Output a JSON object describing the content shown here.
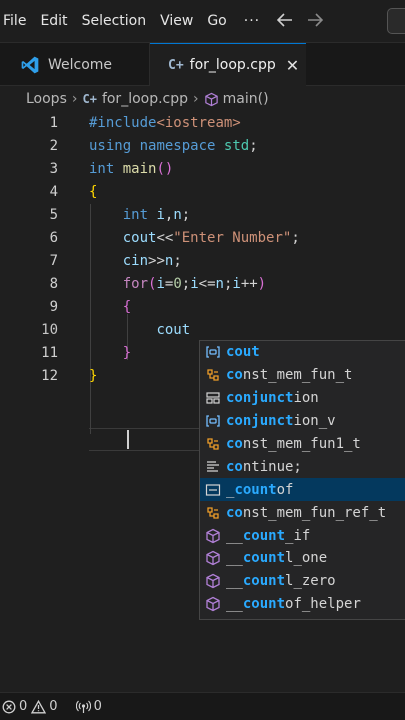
{
  "menubar": {
    "items": [
      "File",
      "Edit",
      "Selection",
      "View",
      "Go"
    ],
    "more": "···",
    "back_icon": "arrow-left-icon",
    "forward_icon": "arrow-right-icon"
  },
  "tabs": [
    {
      "label": "Welcome",
      "icon": "vscode-logo-icon"
    },
    {
      "label": "for_loop.cpp",
      "icon": "cpp-file-icon",
      "icon_glyph": "C+",
      "close": "✕"
    }
  ],
  "breadcrumb": {
    "folder": "Loops",
    "file": "for_loop.cpp",
    "symbol": "main()"
  },
  "editor": {
    "lines": [
      {
        "n": "1",
        "tokens": [
          [
            "c-pre",
            "#include"
          ],
          [
            "c-str",
            "<iostream>"
          ]
        ]
      },
      {
        "n": "2",
        "tokens": [
          [
            "c-kw",
            "using"
          ],
          [
            "c-txt",
            " "
          ],
          [
            "c-kw",
            "namespace"
          ],
          [
            "c-txt",
            " "
          ],
          [
            "c-ns",
            "std"
          ],
          [
            "c-txt",
            ";"
          ]
        ]
      },
      {
        "n": "3",
        "tokens": [
          [
            "c-kw",
            "int"
          ],
          [
            "c-txt",
            " "
          ],
          [
            "c-fn",
            "main"
          ],
          [
            "c-brace2",
            "()"
          ]
        ]
      },
      {
        "n": "4",
        "tokens": [
          [
            "c-brace",
            "{"
          ]
        ]
      },
      {
        "n": "5",
        "tokens": [
          [
            "c-txt",
            "    "
          ],
          [
            "c-kw",
            "int"
          ],
          [
            "c-txt",
            " "
          ],
          [
            "c-var",
            "i"
          ],
          [
            "c-txt",
            ","
          ],
          [
            "c-var",
            "n"
          ],
          [
            "c-txt",
            ";"
          ]
        ]
      },
      {
        "n": "6",
        "tokens": [
          [
            "c-txt",
            "    "
          ],
          [
            "c-var",
            "cout"
          ],
          [
            "c-txt",
            "<<"
          ],
          [
            "c-str",
            "\"Enter Number\""
          ],
          [
            "c-txt",
            ";"
          ]
        ]
      },
      {
        "n": "7",
        "tokens": [
          [
            "c-txt",
            "    "
          ],
          [
            "c-var",
            "cin"
          ],
          [
            "c-txt",
            ">>"
          ],
          [
            "c-var",
            "n"
          ],
          [
            "c-txt",
            ";"
          ]
        ]
      },
      {
        "n": "8",
        "tokens": [
          [
            "c-txt",
            "    "
          ],
          [
            "c-kw2",
            "for"
          ],
          [
            "c-brace2",
            "("
          ],
          [
            "c-var",
            "i"
          ],
          [
            "c-txt",
            "="
          ],
          [
            "c-num",
            "0"
          ],
          [
            "c-txt",
            ";"
          ],
          [
            "c-var",
            "i"
          ],
          [
            "c-txt",
            "<="
          ],
          [
            "c-var",
            "n"
          ],
          [
            "c-txt",
            ";"
          ],
          [
            "c-var",
            "i"
          ],
          [
            "c-txt",
            "++"
          ],
          [
            "c-brace2",
            ")"
          ]
        ]
      },
      {
        "n": "9",
        "tokens": [
          [
            "c-txt",
            "    "
          ],
          [
            "c-brace2",
            "{"
          ]
        ]
      },
      {
        "n": "10",
        "tokens": [
          [
            "c-txt",
            "        "
          ],
          [
            "c-var",
            "cout"
          ]
        ]
      },
      {
        "n": "11",
        "tokens": [
          [
            "c-txt",
            "    "
          ],
          [
            "c-brace2",
            "}"
          ]
        ]
      },
      {
        "n": "12",
        "tokens": [
          [
            "c-brace",
            "}"
          ]
        ]
      }
    ],
    "current_line": "10"
  },
  "suggestions": [
    {
      "kind": "variable",
      "pre": "",
      "match": "cout",
      "post": "",
      "selected": false
    },
    {
      "kind": "class",
      "pre": "",
      "match": "co",
      "post": "nst_mem_fun_t",
      "selected": false
    },
    {
      "kind": "enum",
      "pre": "",
      "match": "conjunct",
      "post": "ion",
      "selected": false
    },
    {
      "kind": "variable",
      "pre": "",
      "match": "conjunct",
      "post": "ion_v",
      "selected": false
    },
    {
      "kind": "class",
      "pre": "",
      "match": "co",
      "post": "nst_mem_fun1_t",
      "selected": false
    },
    {
      "kind": "snippet",
      "pre": "",
      "match": "co",
      "post": "ntinue;",
      "selected": false
    },
    {
      "kind": "keyword-box",
      "pre": "_",
      "match": "count",
      "post": "of",
      "selected": true
    },
    {
      "kind": "class",
      "pre": "",
      "match": "co",
      "post": "nst_mem_fun_ref_t",
      "selected": false
    },
    {
      "kind": "cube",
      "pre": "__",
      "match": "count",
      "post": "_if",
      "selected": false
    },
    {
      "kind": "cube",
      "pre": "__",
      "match": "count",
      "post": "l_one",
      "selected": false
    },
    {
      "kind": "cube",
      "pre": "__",
      "match": "count",
      "post": "l_zero",
      "selected": false
    },
    {
      "kind": "cube",
      "pre": "__",
      "match": "count",
      "post": "of_helper",
      "selected": false
    }
  ],
  "statusbar": {
    "errors": "0",
    "warnings": "0",
    "ports": "0"
  },
  "colors": {
    "accent": "#0078d4",
    "match": "#2aaaff",
    "selected_bg": "#04395e"
  }
}
